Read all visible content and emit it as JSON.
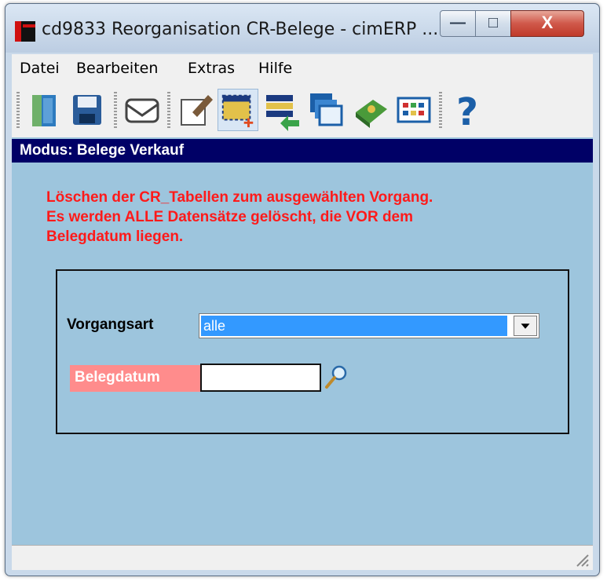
{
  "window": {
    "title": "cd9833 Reorganisation CR-Belege - cimERP ...",
    "controls": {
      "minimize": "—",
      "maximize": "□",
      "close": "X"
    }
  },
  "menu": [
    "Datei",
    "Bearbeiten",
    "Extras",
    "Hilfe"
  ],
  "toolbar": [
    {
      "name": "exit-door-icon"
    },
    {
      "name": "save-disk-icon"
    },
    {
      "name": "mail-envelope-icon"
    },
    {
      "name": "edit-form-icon"
    },
    {
      "name": "new-selection-icon",
      "active": true
    },
    {
      "name": "list-import-icon"
    },
    {
      "name": "windows-stack-icon"
    },
    {
      "name": "book-icon"
    },
    {
      "name": "table-view-icon"
    },
    {
      "name": "help-icon"
    }
  ],
  "mode": {
    "label": "Modus: Belege Verkauf"
  },
  "warning": {
    "lines": [
      "Löschen der CR_Tabellen zum ausgewählten Vorgang.",
      "Es werden ALLE Datensätze gelöscht, die VOR dem",
      "Belegdatum liegen."
    ],
    "color": "#ff1a1a"
  },
  "form": {
    "vorgangsart": {
      "label": "Vorgangsart",
      "value": "alle"
    },
    "belegdatum": {
      "label": "Belegdatum",
      "value": "",
      "required_color": "#ff8c8c"
    }
  },
  "colors": {
    "client_bg": "#9dc5dd",
    "modebar_bg": "#000066",
    "selection": "#3399ff"
  }
}
